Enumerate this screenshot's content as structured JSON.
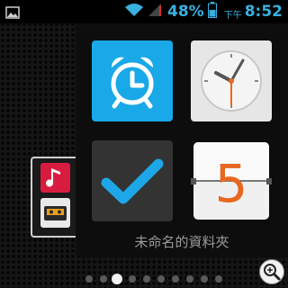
{
  "status_bar": {
    "notification_icon": "image-notification-icon",
    "wifi_icon": "wifi-icon",
    "signal_icon": "signal-icon",
    "battery_percent": "48%",
    "battery_icon": "battery-icon",
    "ampm": "下午",
    "time": "8:52"
  },
  "folder": {
    "name": "未命名的資料夾",
    "apps": [
      {
        "icon": "alarm-clock-icon",
        "color": "#19a8e8"
      },
      {
        "icon": "analog-clock-icon",
        "color": "#e6e6e6"
      },
      {
        "icon": "checkmark-icon",
        "color": "#333333"
      },
      {
        "icon": "flip-calendar-icon",
        "color": "#f0f0f0",
        "digit": "5"
      }
    ]
  },
  "folder_thumbnail": {
    "icons": [
      "music-note-icon",
      "cassette-icon"
    ]
  },
  "page_indicator": {
    "total": 10,
    "active_index": 2
  },
  "colors": {
    "accent": "#3ab0e0",
    "checkmark": "#1ea7e8",
    "calendar_digit": "#e8681f",
    "clock_second_hand": "#e8681f"
  },
  "zoom_icon": "magnifier-zoom-icon"
}
